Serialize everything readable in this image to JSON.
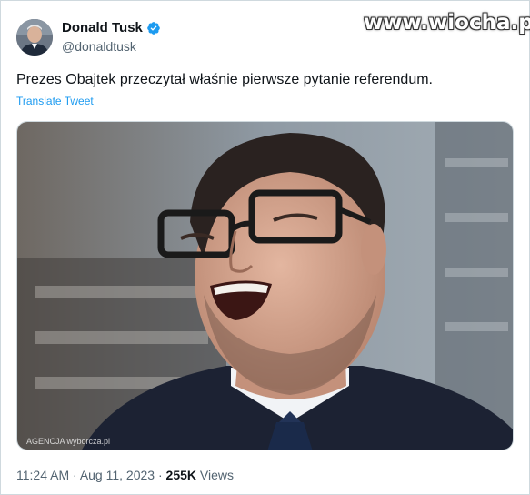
{
  "author": {
    "display_name": "Donald Tusk",
    "handle": "@donaldtusk",
    "verified_icon": "verified-badge-icon",
    "verified_color": "#1d9bf0"
  },
  "watermark": "www.wiocha.pl",
  "tweet": {
    "text": "Prezes Obajtek przeczytał właśnie pierwsze pytanie referendum.",
    "translate_label": "Translate Tweet"
  },
  "media": {
    "credit": "AGENCJA wyborcza.pl"
  },
  "meta": {
    "time": "11:24 AM",
    "date": "Aug 11, 2023",
    "separator": "·",
    "views_count": "255K",
    "views_label": "Views"
  },
  "colors": {
    "link": "#1d9bf0",
    "secondary_text": "#536471",
    "primary_text": "#0f1419",
    "border": "#cfd9de"
  }
}
